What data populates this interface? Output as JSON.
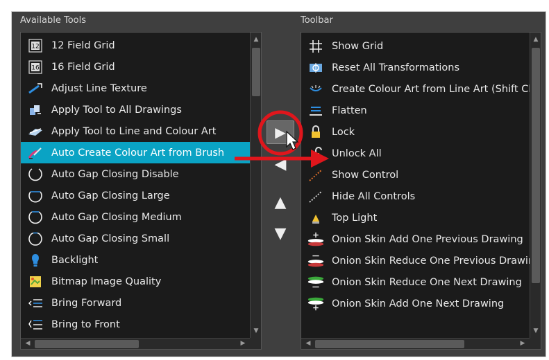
{
  "available": {
    "label": "Available Tools",
    "items": [
      {
        "label": "12 Field Grid",
        "icon": "field-grid-12-icon"
      },
      {
        "label": "16 Field Grid",
        "icon": "field-grid-16-icon"
      },
      {
        "label": "Adjust Line Texture",
        "icon": "adjust-line-texture-icon"
      },
      {
        "label": "Apply Tool to All Drawings",
        "icon": "apply-all-drawings-icon"
      },
      {
        "label": "Apply Tool to Line and Colour Art",
        "icon": "apply-line-colour-icon"
      },
      {
        "label": "Auto Create Colour Art from Brush",
        "icon": "auto-colour-art-icon",
        "selected": true
      },
      {
        "label": "Auto Gap Closing Disable",
        "icon": "gap-disable-icon"
      },
      {
        "label": "Auto Gap Closing Large",
        "icon": "gap-large-icon"
      },
      {
        "label": "Auto Gap Closing Medium",
        "icon": "gap-medium-icon"
      },
      {
        "label": "Auto Gap Closing Small",
        "icon": "gap-small-icon"
      },
      {
        "label": "Backlight",
        "icon": "backlight-icon"
      },
      {
        "label": "Bitmap Image Quality",
        "icon": "bitmap-quality-icon"
      },
      {
        "label": "Bring Forward",
        "icon": "bring-forward-icon"
      },
      {
        "label": "Bring to Front",
        "icon": "bring-to-front-icon"
      }
    ]
  },
  "toolbar": {
    "label": "Toolbar",
    "items": [
      {
        "label": "Show Grid",
        "icon": "grid-icon"
      },
      {
        "label": "Reset All Transformations",
        "icon": "reset-transform-icon"
      },
      {
        "label": "Create Colour Art from Line Art (Shift Clicl",
        "icon": "create-colour-art-icon"
      },
      {
        "label": "Flatten",
        "icon": "flatten-icon"
      },
      {
        "label": "Lock",
        "icon": "lock-icon"
      },
      {
        "label": "Unlock All",
        "icon": "unlock-icon"
      },
      {
        "label": "Show Control",
        "icon": "show-control-icon"
      },
      {
        "label": "Hide All Controls",
        "icon": "hide-controls-icon"
      },
      {
        "label": "Top Light",
        "icon": "top-light-icon"
      },
      {
        "label": "Onion Skin Add One Previous Drawing",
        "icon": "onion-add-previous-icon"
      },
      {
        "label": "Onion Skin Reduce One Previous Drawing",
        "icon": "onion-reduce-previous-icon"
      },
      {
        "label": "Onion Skin Reduce One Next Drawing",
        "icon": "onion-reduce-next-icon"
      },
      {
        "label": "Onion Skin Add One Next Drawing",
        "icon": "onion-add-next-icon"
      }
    ]
  },
  "buttons": {
    "add": "▶",
    "remove": "◀",
    "up": "▲",
    "down": "▼"
  },
  "scroll_arrows": {
    "up": "▲",
    "down": "▼",
    "left": "◀",
    "right": "▶"
  },
  "colors": {
    "selection": "#0aa3c4",
    "annotation": "#e0161c",
    "panel": "#3f3f3f",
    "list_bg": "#1b1b1b"
  }
}
